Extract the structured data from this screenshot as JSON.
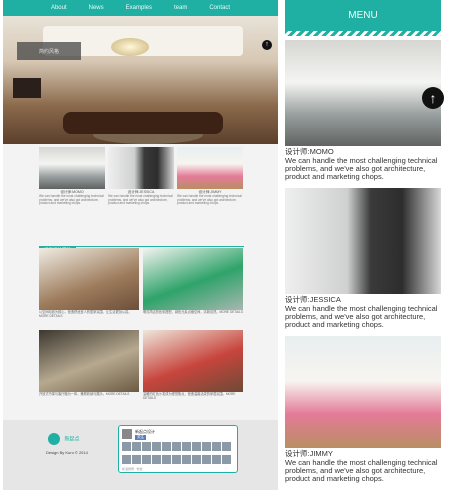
{
  "nav": {
    "items": [
      "About",
      "News",
      "Examples",
      "team",
      "Contact"
    ]
  },
  "hero": {
    "caption": "简约风格"
  },
  "thumbs": [
    {
      "title": "设计师:MOMO",
      "desc": "We can handle the most challenging technical problems, and we've also got architecture, product and marketing chops."
    },
    {
      "title": "设计师:JESSICA",
      "desc": "We can handle the most challenging technical problems, and we've also got architecture, product and marketing chops."
    },
    {
      "title": "设计师:JIMMY",
      "desc": "We can handle the most challenging technical problems, and we've also got architecture, product and marketing chops."
    }
  ],
  "section": {
    "title": "样板设计赏析"
  },
  "grid": [
    {
      "caption": "以空间动线为核心，营造舒适宜人的居家氛围，让生活更加从容。MORE DETAILS"
    },
    {
      "caption": "明亮简洁的色彩搭配，绿色元素点缀空间，清新自然。MORE DETAILS"
    },
    {
      "caption": "开放式书架与客厅融为一体，兼顾收纳与展示。MORE DETAILS"
    },
    {
      "caption": "温暖的红色沙发成为视觉焦点，营造温馨活泼的家居氛围。MORE DETAILS"
    }
  ],
  "footer": {
    "logo_text": "新起点",
    "copyright": "Design By Kuro © 2014"
  },
  "social": {
    "name": "新起点设计",
    "follow": "关注",
    "foot": "新浪微博 · 粉丝"
  },
  "side": {
    "menu": "MENU",
    "cards": [
      {
        "name": "设计师:MOMO",
        "desc": "We can handle the most challenging technical problems, and we've also got architecture, product and marketing chops."
      },
      {
        "name": "设计师:JESSICA",
        "desc": "We can handle the most challenging technical problems, and we've also got architecture, product and marketing chops."
      },
      {
        "name": "设计师:JIMMY",
        "desc": "We can handle the most challenging technical problems, and we've also got architecture, product and marketing chops."
      }
    ]
  },
  "icons": {
    "back_to_top": "arrow-up-icon"
  },
  "colors": {
    "accent": "#1fb0a3"
  }
}
